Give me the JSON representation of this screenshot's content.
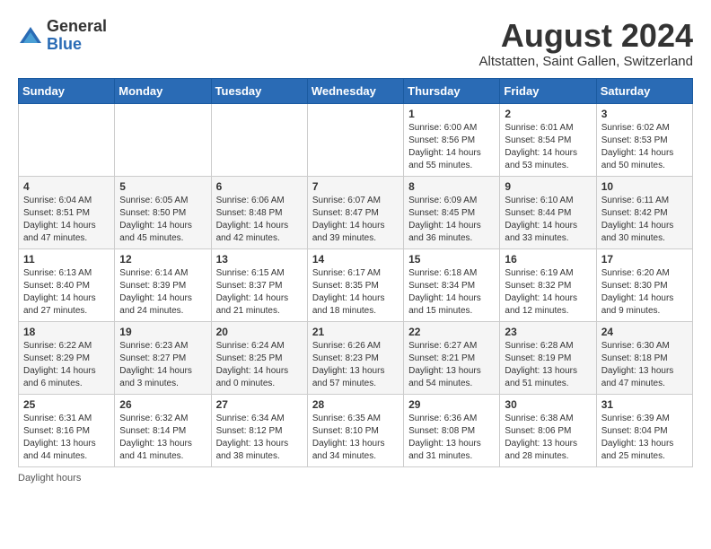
{
  "logo": {
    "general": "General",
    "blue": "Blue"
  },
  "title": {
    "month_year": "August 2024",
    "location": "Altstatten, Saint Gallen, Switzerland"
  },
  "weekdays": [
    "Sunday",
    "Monday",
    "Tuesday",
    "Wednesday",
    "Thursday",
    "Friday",
    "Saturday"
  ],
  "weeks": [
    [
      {
        "day": "",
        "info": ""
      },
      {
        "day": "",
        "info": ""
      },
      {
        "day": "",
        "info": ""
      },
      {
        "day": "",
        "info": ""
      },
      {
        "day": "1",
        "info": "Sunrise: 6:00 AM\nSunset: 8:56 PM\nDaylight: 14 hours and 55 minutes."
      },
      {
        "day": "2",
        "info": "Sunrise: 6:01 AM\nSunset: 8:54 PM\nDaylight: 14 hours and 53 minutes."
      },
      {
        "day": "3",
        "info": "Sunrise: 6:02 AM\nSunset: 8:53 PM\nDaylight: 14 hours and 50 minutes."
      }
    ],
    [
      {
        "day": "4",
        "info": "Sunrise: 6:04 AM\nSunset: 8:51 PM\nDaylight: 14 hours and 47 minutes."
      },
      {
        "day": "5",
        "info": "Sunrise: 6:05 AM\nSunset: 8:50 PM\nDaylight: 14 hours and 45 minutes."
      },
      {
        "day": "6",
        "info": "Sunrise: 6:06 AM\nSunset: 8:48 PM\nDaylight: 14 hours and 42 minutes."
      },
      {
        "day": "7",
        "info": "Sunrise: 6:07 AM\nSunset: 8:47 PM\nDaylight: 14 hours and 39 minutes."
      },
      {
        "day": "8",
        "info": "Sunrise: 6:09 AM\nSunset: 8:45 PM\nDaylight: 14 hours and 36 minutes."
      },
      {
        "day": "9",
        "info": "Sunrise: 6:10 AM\nSunset: 8:44 PM\nDaylight: 14 hours and 33 minutes."
      },
      {
        "day": "10",
        "info": "Sunrise: 6:11 AM\nSunset: 8:42 PM\nDaylight: 14 hours and 30 minutes."
      }
    ],
    [
      {
        "day": "11",
        "info": "Sunrise: 6:13 AM\nSunset: 8:40 PM\nDaylight: 14 hours and 27 minutes."
      },
      {
        "day": "12",
        "info": "Sunrise: 6:14 AM\nSunset: 8:39 PM\nDaylight: 14 hours and 24 minutes."
      },
      {
        "day": "13",
        "info": "Sunrise: 6:15 AM\nSunset: 8:37 PM\nDaylight: 14 hours and 21 minutes."
      },
      {
        "day": "14",
        "info": "Sunrise: 6:17 AM\nSunset: 8:35 PM\nDaylight: 14 hours and 18 minutes."
      },
      {
        "day": "15",
        "info": "Sunrise: 6:18 AM\nSunset: 8:34 PM\nDaylight: 14 hours and 15 minutes."
      },
      {
        "day": "16",
        "info": "Sunrise: 6:19 AM\nSunset: 8:32 PM\nDaylight: 14 hours and 12 minutes."
      },
      {
        "day": "17",
        "info": "Sunrise: 6:20 AM\nSunset: 8:30 PM\nDaylight: 14 hours and 9 minutes."
      }
    ],
    [
      {
        "day": "18",
        "info": "Sunrise: 6:22 AM\nSunset: 8:29 PM\nDaylight: 14 hours and 6 minutes."
      },
      {
        "day": "19",
        "info": "Sunrise: 6:23 AM\nSunset: 8:27 PM\nDaylight: 14 hours and 3 minutes."
      },
      {
        "day": "20",
        "info": "Sunrise: 6:24 AM\nSunset: 8:25 PM\nDaylight: 14 hours and 0 minutes."
      },
      {
        "day": "21",
        "info": "Sunrise: 6:26 AM\nSunset: 8:23 PM\nDaylight: 13 hours and 57 minutes."
      },
      {
        "day": "22",
        "info": "Sunrise: 6:27 AM\nSunset: 8:21 PM\nDaylight: 13 hours and 54 minutes."
      },
      {
        "day": "23",
        "info": "Sunrise: 6:28 AM\nSunset: 8:19 PM\nDaylight: 13 hours and 51 minutes."
      },
      {
        "day": "24",
        "info": "Sunrise: 6:30 AM\nSunset: 8:18 PM\nDaylight: 13 hours and 47 minutes."
      }
    ],
    [
      {
        "day": "25",
        "info": "Sunrise: 6:31 AM\nSunset: 8:16 PM\nDaylight: 13 hours and 44 minutes."
      },
      {
        "day": "26",
        "info": "Sunrise: 6:32 AM\nSunset: 8:14 PM\nDaylight: 13 hours and 41 minutes."
      },
      {
        "day": "27",
        "info": "Sunrise: 6:34 AM\nSunset: 8:12 PM\nDaylight: 13 hours and 38 minutes."
      },
      {
        "day": "28",
        "info": "Sunrise: 6:35 AM\nSunset: 8:10 PM\nDaylight: 13 hours and 34 minutes."
      },
      {
        "day": "29",
        "info": "Sunrise: 6:36 AM\nSunset: 8:08 PM\nDaylight: 13 hours and 31 minutes."
      },
      {
        "day": "30",
        "info": "Sunrise: 6:38 AM\nSunset: 8:06 PM\nDaylight: 13 hours and 28 minutes."
      },
      {
        "day": "31",
        "info": "Sunrise: 6:39 AM\nSunset: 8:04 PM\nDaylight: 13 hours and 25 minutes."
      }
    ]
  ],
  "footer": {
    "note": "Daylight hours"
  }
}
